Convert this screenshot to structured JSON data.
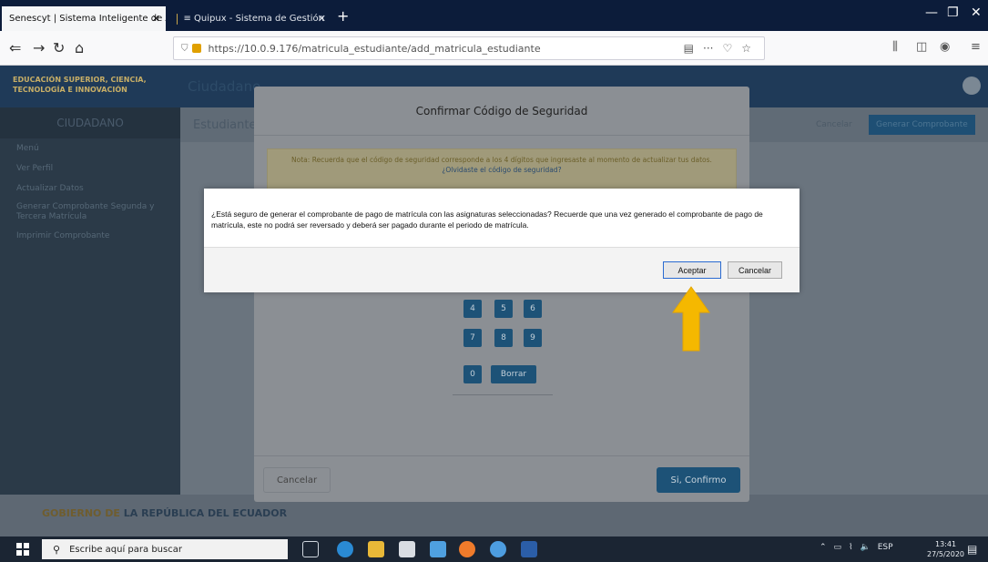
{
  "browser": {
    "tabs": [
      {
        "label": "Senescyt | Sistema Inteligente de A..."
      },
      {
        "label": "≡ Quipux - Sistema de Gestión"
      }
    ],
    "url": "https://10.0.9.176/matricula_estudiante/add_matricula_estudiante"
  },
  "page": {
    "brand": "EDUCACIÓN SUPERIOR, CIENCIA, TECNOLOGÍA E INNOVACIÓN",
    "header_title": "Ciudadano",
    "sidebar_head": "CIUDADANO",
    "sidebar": [
      {
        "label": "Menú"
      },
      {
        "label": "Ver Perfil"
      },
      {
        "label": "Actualizar Datos"
      },
      {
        "label": "Generar Comprobante Segunda y Tercera Matrícula"
      },
      {
        "label": "Imprimir Comprobante"
      }
    ],
    "content_title": "Estudiante",
    "btn_cancel": "Cancelar",
    "btn_generate": "Generar Comprobante",
    "footer_prefix": "GOBIERNO DE",
    "footer_main": "LA REPÚBLICA DEL ECUADOR"
  },
  "code_modal": {
    "title": "Confirmar Código de Seguridad",
    "note": "Nota: Recuerda que el código de seguridad corresponde a los 4 dígitos que ingresaste al momento de actualizar tus datos.",
    "forgot_link": "¿Olvidaste el código de seguridad?",
    "keys": [
      "4",
      "5",
      "6",
      "7",
      "8",
      "9",
      "0"
    ],
    "delete_key": "Borrar",
    "cancel": "Cancelar",
    "confirm": "Si, Confirmo"
  },
  "dialog": {
    "message": "¿Está seguro de generar el comprobante de pago de matrícula con las asignaturas seleccionadas? Recuerde que una vez generado el comprobante de pago de matrícula, este no podrá ser reversado y deberá ser pagado durante el periodo de matrícula.",
    "accept": "Aceptar",
    "cancel": "Cancelar"
  },
  "taskbar": {
    "search_placeholder": "Escribe aquí para buscar",
    "language": "ESP",
    "time": "13:41",
    "date": "27/5/2020"
  },
  "colors": {
    "arrow": "#f5b800",
    "accent": "#1d5277"
  }
}
